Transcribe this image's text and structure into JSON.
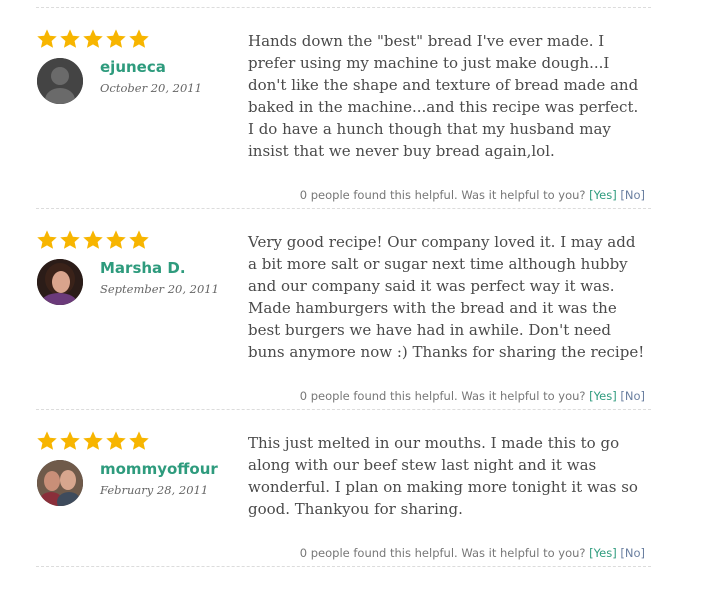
{
  "colors": {
    "star": "#f7b500",
    "name": "#2e9b7d",
    "text": "#4a4a4a"
  },
  "reviews": [
    {
      "rating": 5,
      "name": "ejuneca",
      "date": "October 20, 2011",
      "text": "Hands down the \"best\" bread I've ever made. I prefer using my machine to just make dough...I don't like the shape and texture of bread made and baked in the machine...and this recipe was perfect. I do have a hunch though that my husband may insist that we never buy bread again,lol.",
      "helpful_prompt": "0 people found this helpful. Was it helpful to you?",
      "yes": "[Yes]",
      "no": "[No]"
    },
    {
      "rating": 5,
      "name": "Marsha D.",
      "date": "September 20, 2011",
      "text": "Very good recipe! Our company loved it. I may add a bit more salt or sugar next time although hubby and our company said it was perfect way it was. Made hamburgers with the bread and it was the best burgers we have had in awhile. Don't need buns anymore now :) Thanks for sharing the recipe!",
      "helpful_prompt": "0 people found this helpful. Was it helpful to you?",
      "yes": "[Yes]",
      "no": "[No]"
    },
    {
      "rating": 5,
      "name": "mommyoffour",
      "date": "February 28, 2011",
      "text": "This just melted in our mouths. I made this to go along with our beef stew last night and it was wonderful. I plan on making more tonight it was so good. Thankyou for sharing.",
      "helpful_prompt": "0 people found this helpful. Was it helpful to you?",
      "yes": "[Yes]",
      "no": "[No]"
    }
  ]
}
